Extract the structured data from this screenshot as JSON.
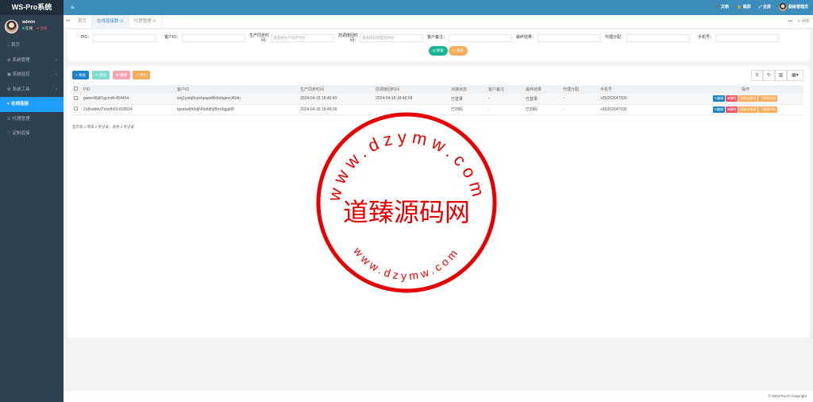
{
  "app": {
    "title": "WS-Pro系统"
  },
  "user": {
    "name": "admin",
    "status": "在线",
    "logout": "注销"
  },
  "sidebar": {
    "items": [
      {
        "icon": "⌂",
        "label": "首页",
        "arrow": ""
      },
      {
        "icon": "⚙",
        "label": "系统管理",
        "arrow": "‹"
      },
      {
        "icon": "▣",
        "label": "系统监控",
        "arrow": "‹"
      },
      {
        "icon": "⚒",
        "label": "系统工具",
        "arrow": "‹"
      },
      {
        "icon": "♥",
        "label": "在线连接",
        "arrow": ""
      },
      {
        "icon": "☷",
        "label": "代理管理",
        "arrow": ""
      },
      {
        "icon": "♡",
        "label": "定制连接",
        "arrow": ""
      }
    ]
  },
  "topbar": {
    "menu_icon": "≡",
    "links": [
      "文档",
      "锁屏",
      "全屏"
    ],
    "user_name": "超级管理员"
  },
  "tabbar": {
    "tabs": [
      "首页",
      "在线连接数 ⊙",
      "代理管理 ⊙"
    ],
    "refresh": "刷新"
  },
  "search": {
    "fields": [
      {
        "label": "PID：",
        "placeholder": ""
      },
      {
        "label": "客户ID：",
        "placeholder": ""
      },
      {
        "label": "生产同步时间：",
        "placeholder": "请选择生产同步时间"
      },
      {
        "label": "前调度回时间：",
        "placeholder": "请选择前调度回时间"
      },
      {
        "label": "客户备注：",
        "placeholder": ""
      },
      {
        "label": "最终结果：",
        "placeholder": ""
      },
      {
        "label": "代理分配：",
        "placeholder": ""
      },
      {
        "label": "手机号：",
        "placeholder": ""
      }
    ],
    "search_button": "Q 搜索",
    "reset_button": "↻ 重置"
  },
  "toolbar": {
    "add": "+ 添加",
    "edit": "✎ 修改",
    "delete": "✖ 删除",
    "export": "⇩ 导出"
  },
  "table": {
    "headers": [
      "",
      "PID",
      "客户ID",
      "生产同步时间",
      "前调度回时间",
      "对接状态",
      "客户备注",
      "最终结果",
      "代理分配",
      "手机号",
      "操作"
    ],
    "rows": [
      [
        "gwee46jkf1gcmdt-454454",
        "wcj1pxbj8cpehpajsi8fx6obgevc40dn",
        "2024-04-18 18:46:40",
        "2024-04-18 18:46:09",
        "已登录",
        "-",
        "已登录",
        "-",
        "+85262647930"
      ],
      [
        "2u8sdddvl7nlodh03-603634",
        "tgsqta4jh9dj649dtdhjf8nx9gjgk8f",
        "2024-04-18 18:48:39",
        "",
        "已扫码",
        "-",
        "已扫码",
        "-",
        "+85262647930"
      ]
    ],
    "actions": [
      "✎编辑",
      "✖删除",
      "获取出售码",
      "下载源代码"
    ],
    "pager": "显示第 1 到第 2 条记录，总共 2 条记录"
  },
  "footer": {
    "copyright": "© 2023 RuoYi Copyright"
  },
  "watermark": {
    "top_text": "www.dzymw.com",
    "center_text": "道臻源码网",
    "bottom_text": "www.dzymw.com"
  },
  "colors": {
    "sidebar": "#2f4050",
    "topbar": "#3c8dbc",
    "active": "#1e9fff",
    "seal": "#e60000"
  }
}
